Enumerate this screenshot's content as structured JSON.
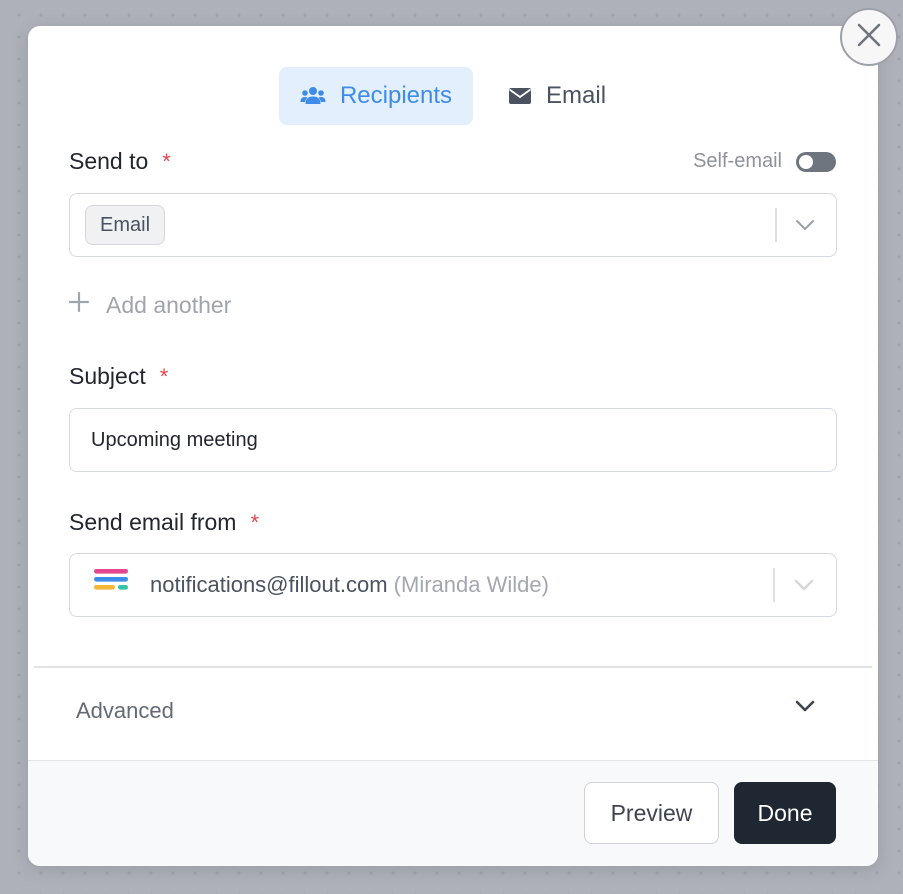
{
  "tabs": [
    {
      "label": "Recipients",
      "icon": "users-icon",
      "active": true
    },
    {
      "label": "Email",
      "icon": "envelope-icon",
      "active": false
    }
  ],
  "send_to": {
    "label": "Send to",
    "required_mark": "*",
    "self_email_label": "Self-email",
    "self_email_on": false,
    "chip": "Email"
  },
  "add_another_label": "Add another",
  "subject": {
    "label": "Subject",
    "required_mark": "*",
    "value": "Upcoming meeting"
  },
  "send_from": {
    "label": "Send email from",
    "required_mark": "*",
    "email": "notifications@fillout.com",
    "name": "(Miranda Wilde)"
  },
  "advanced_label": "Advanced",
  "footer": {
    "preview_label": "Preview",
    "done_label": "Done"
  },
  "colors": {
    "accent": "#3f8ce8",
    "accent_bg": "#e3effd",
    "required": "#e5484d",
    "done_bg": "#1f2733",
    "logo_pink": "#e5468f",
    "logo_blue": "#3b8de8",
    "logo_yellow": "#f4b73a",
    "logo_green": "#36c2a4"
  }
}
